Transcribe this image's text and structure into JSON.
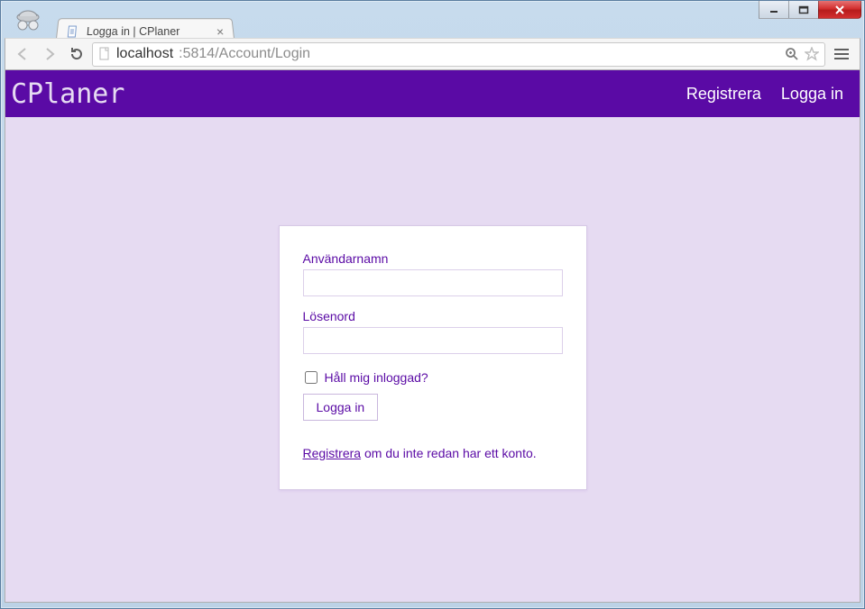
{
  "browser": {
    "tab_title": "Logga in | CPlaner",
    "url_host": "localhost",
    "url_rest": ":5814/Account/Login"
  },
  "app": {
    "brand": "CPlaner",
    "nav": {
      "register": "Registrera",
      "login": "Logga in"
    }
  },
  "form": {
    "username_label": "Användarnamn",
    "username_value": "",
    "password_label": "Lösenord",
    "password_value": "",
    "remember_label": "Håll mig inloggad?",
    "remember_checked": false,
    "submit_label": "Logga in",
    "register_link_text": "Registrera",
    "register_hint_suffix": " om du inte redan har ett konto."
  }
}
